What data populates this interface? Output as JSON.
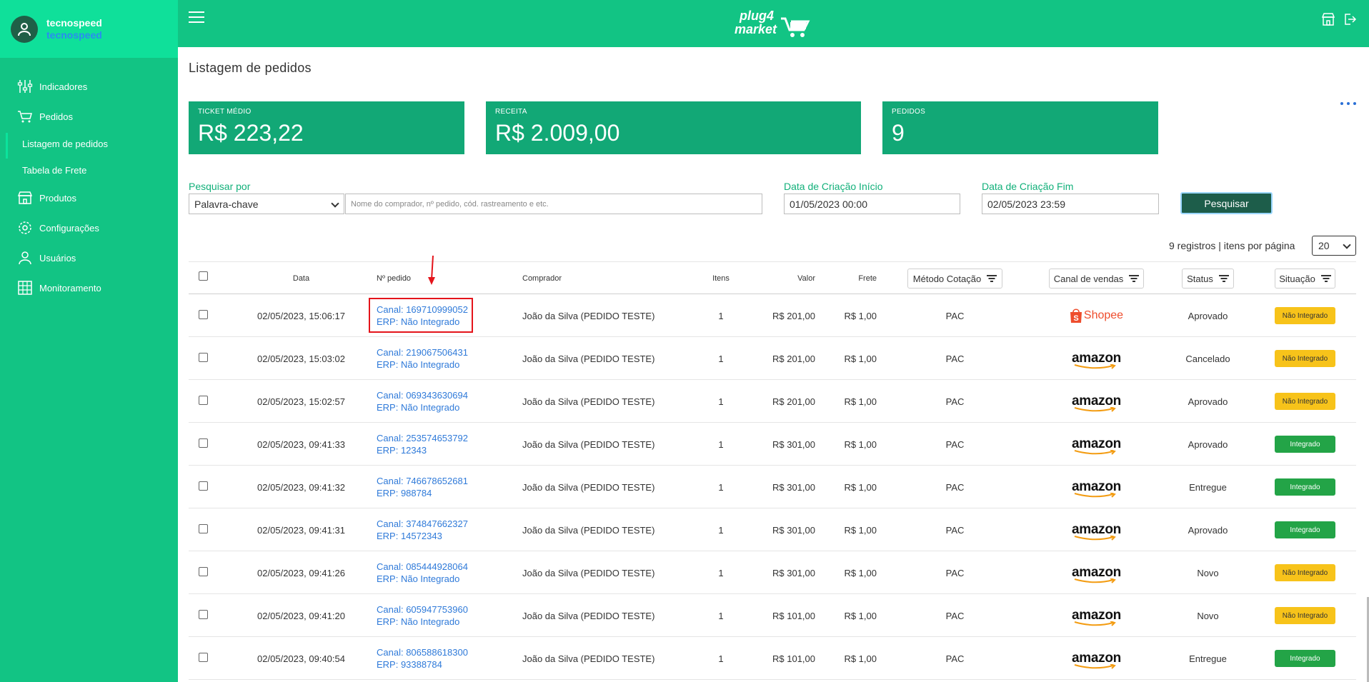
{
  "user": {
    "name": "tecnospeed",
    "company": "tecnospeed"
  },
  "sidebar": {
    "items": [
      {
        "label": "Indicadores",
        "icon": "sliders-icon"
      },
      {
        "label": "Pedidos",
        "icon": "cart-icon"
      },
      {
        "label": "Listagem de pedidos",
        "sub": true,
        "active": true
      },
      {
        "label": "Tabela de Frete",
        "sub": true
      },
      {
        "label": "Produtos",
        "icon": "store-icon"
      },
      {
        "label": "Configurações",
        "icon": "gear-icon"
      },
      {
        "label": "Usuários",
        "icon": "user-icon"
      },
      {
        "label": "Monitoramento",
        "icon": "grid-icon"
      }
    ]
  },
  "header": {
    "logo_line1": "plug4",
    "logo_line2": "market"
  },
  "page": {
    "title": "Listagem de pedidos"
  },
  "cards": [
    {
      "label": "TICKET MÉDIO",
      "value": "R$ 223,22"
    },
    {
      "label": "RECEITA",
      "value": "R$ 2.009,00"
    },
    {
      "label": "PEDIDOS",
      "value": "9"
    }
  ],
  "filters": {
    "search_by_label": "Pesquisar por",
    "search_by_value": "Palavra-chave",
    "search_placeholder": "Nome do comprador, nº pedido, cód. rastreamento e etc.",
    "start_label": "Data de Criação Início",
    "start_value": "01/05/2023  00:00",
    "end_label": "Data de Criação Fim",
    "end_value": "02/05/2023  23:59",
    "search_button": "Pesquisar"
  },
  "pagination": {
    "info": "9 registros | itens por página",
    "per_page": "20"
  },
  "table": {
    "headers": {
      "date": "Data",
      "order": "Nº pedido",
      "buyer": "Comprador",
      "items": "Itens",
      "value": "Valor",
      "freight": "Frete",
      "method": "Método Cotação",
      "channel": "Canal de vendas",
      "status": "Status",
      "situation": "Situação"
    },
    "rows": [
      {
        "date": "02/05/2023, 15:06:17",
        "canal": "Canal: 169710999052",
        "erp": "ERP: Não Integrado",
        "buyer": "João da Silva (PEDIDO TESTE)",
        "items": "1",
        "value": "R$ 201,00",
        "freight": "R$ 1,00",
        "method": "PAC",
        "channel": "Shopee",
        "status": "Aprovado",
        "situation": "Não Integrado",
        "sit_type": "ni"
      },
      {
        "date": "02/05/2023, 15:03:02",
        "canal": "Canal: 219067506431",
        "erp": "ERP: Não Integrado",
        "buyer": "João da Silva (PEDIDO TESTE)",
        "items": "1",
        "value": "R$ 201,00",
        "freight": "R$ 1,00",
        "method": "PAC",
        "channel": "amazon",
        "status": "Cancelado",
        "situation": "Não Integrado",
        "sit_type": "ni"
      },
      {
        "date": "02/05/2023, 15:02:57",
        "canal": "Canal: 069343630694",
        "erp": "ERP: Não Integrado",
        "buyer": "João da Silva (PEDIDO TESTE)",
        "items": "1",
        "value": "R$ 201,00",
        "freight": "R$ 1,00",
        "method": "PAC",
        "channel": "amazon",
        "status": "Aprovado",
        "situation": "Não Integrado",
        "sit_type": "ni"
      },
      {
        "date": "02/05/2023, 09:41:33",
        "canal": "Canal: 253574653792",
        "erp": "ERP: 12343",
        "buyer": "João da Silva (PEDIDO TESTE)",
        "items": "1",
        "value": "R$ 301,00",
        "freight": "R$ 1,00",
        "method": "PAC",
        "channel": "amazon",
        "status": "Aprovado",
        "situation": "Integrado",
        "sit_type": "ok"
      },
      {
        "date": "02/05/2023, 09:41:32",
        "canal": "Canal: 746678652681",
        "erp": "ERP: 988784",
        "buyer": "João da Silva (PEDIDO TESTE)",
        "items": "1",
        "value": "R$ 301,00",
        "freight": "R$ 1,00",
        "method": "PAC",
        "channel": "amazon",
        "status": "Entregue",
        "situation": "Integrado",
        "sit_type": "ok"
      },
      {
        "date": "02/05/2023, 09:41:31",
        "canal": "Canal: 374847662327",
        "erp": "ERP: 14572343",
        "buyer": "João da Silva (PEDIDO TESTE)",
        "items": "1",
        "value": "R$ 301,00",
        "freight": "R$ 1,00",
        "method": "PAC",
        "channel": "amazon",
        "status": "Aprovado",
        "situation": "Integrado",
        "sit_type": "ok"
      },
      {
        "date": "02/05/2023, 09:41:26",
        "canal": "Canal: 085444928064",
        "erp": "ERP: Não Integrado",
        "buyer": "João da Silva (PEDIDO TESTE)",
        "items": "1",
        "value": "R$ 301,00",
        "freight": "R$ 1,00",
        "method": "PAC",
        "channel": "amazon",
        "status": "Novo",
        "situation": "Não Integrado",
        "sit_type": "ni"
      },
      {
        "date": "02/05/2023, 09:41:20",
        "canal": "Canal: 605947753960",
        "erp": "ERP: Não Integrado",
        "buyer": "João da Silva (PEDIDO TESTE)",
        "items": "1",
        "value": "R$ 101,00",
        "freight": "R$ 1,00",
        "method": "PAC",
        "channel": "amazon",
        "status": "Novo",
        "situation": "Não Integrado",
        "sit_type": "ni"
      },
      {
        "date": "02/05/2023, 09:40:54",
        "canal": "Canal: 806588618300",
        "erp": "ERP: 93388784",
        "buyer": "João da Silva (PEDIDO TESTE)",
        "items": "1",
        "value": "R$ 101,00",
        "freight": "R$ 1,00",
        "method": "PAC",
        "channel": "amazon",
        "status": "Entregue",
        "situation": "Integrado",
        "sit_type": "ok"
      }
    ]
  },
  "colors": {
    "primary": "#12c484",
    "card": "#12a876",
    "link": "#2f7ad9",
    "warning": "#f7c31a",
    "success": "#23a447",
    "highlight": "#e4141b"
  }
}
